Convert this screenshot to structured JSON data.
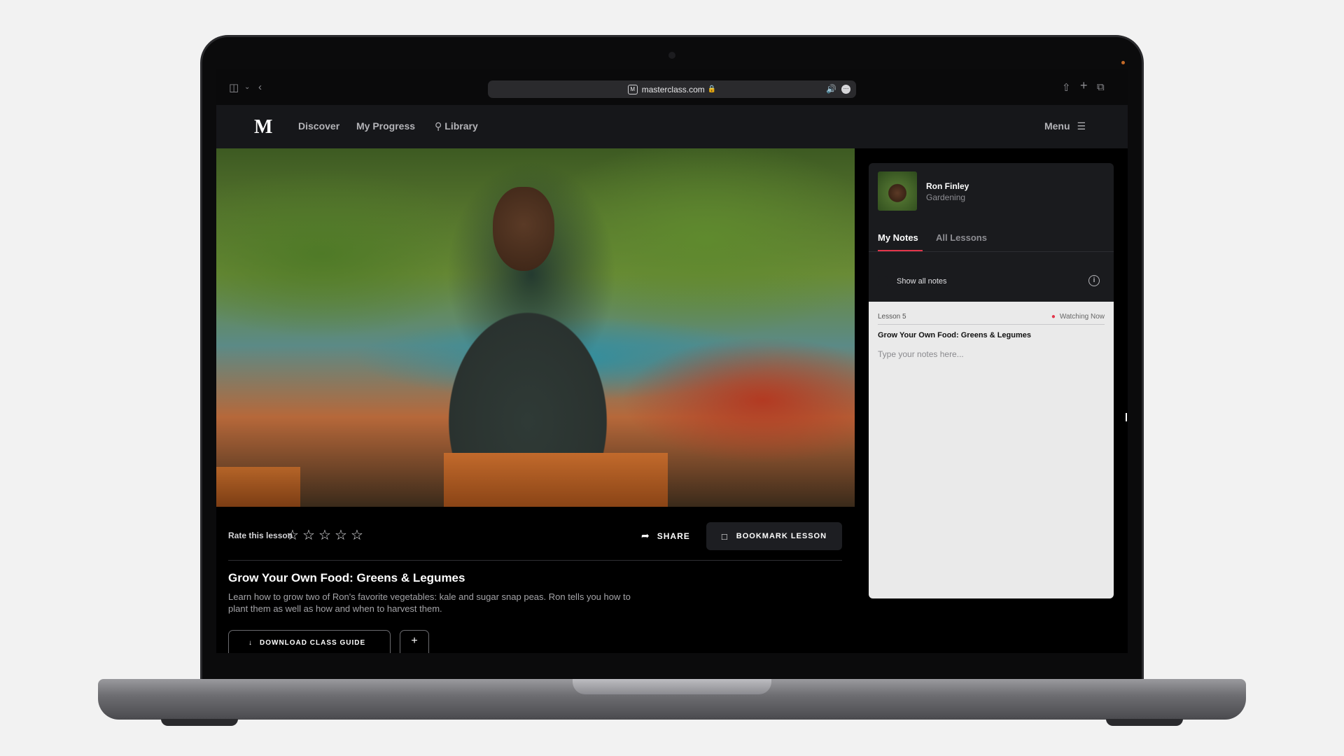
{
  "browser": {
    "url": "masterclass.com",
    "favicon_text": "M"
  },
  "nav": {
    "logo": "M",
    "discover": "Discover",
    "my_progress": "My Progress",
    "library": "Library",
    "menu": "Menu"
  },
  "lesson": {
    "rate_label": "Rate this lesson",
    "rating": 0,
    "max_rating": 5,
    "share_label": "SHARE",
    "bookmark_label": "BOOKMARK LESSON",
    "title": "Grow Your Own Food: Greens & Legumes",
    "description": "Learn how to grow two of Ron's favorite vegetables: kale and sugar snap peas. Ron tells you how to plant them as well as how and when to harvest them.",
    "download_label": "DOWNLOAD CLASS GUIDE",
    "add_label": "+"
  },
  "panel": {
    "instructor_name": "Ron Finley",
    "instructor_category": "Gardening",
    "tabs": [
      "My Notes",
      "All Lessons"
    ],
    "active_tab": "My Notes",
    "show_all_notes": "Show all notes",
    "show_all_checked": false,
    "note": {
      "lesson_number": "Lesson 5",
      "status": "Watching Now",
      "title": "Grow Your Own Food: Greens & Legumes",
      "placeholder": "Type your notes here..."
    }
  },
  "colors": {
    "accent": "#e2354a",
    "speaker": "#3b8cf5"
  }
}
